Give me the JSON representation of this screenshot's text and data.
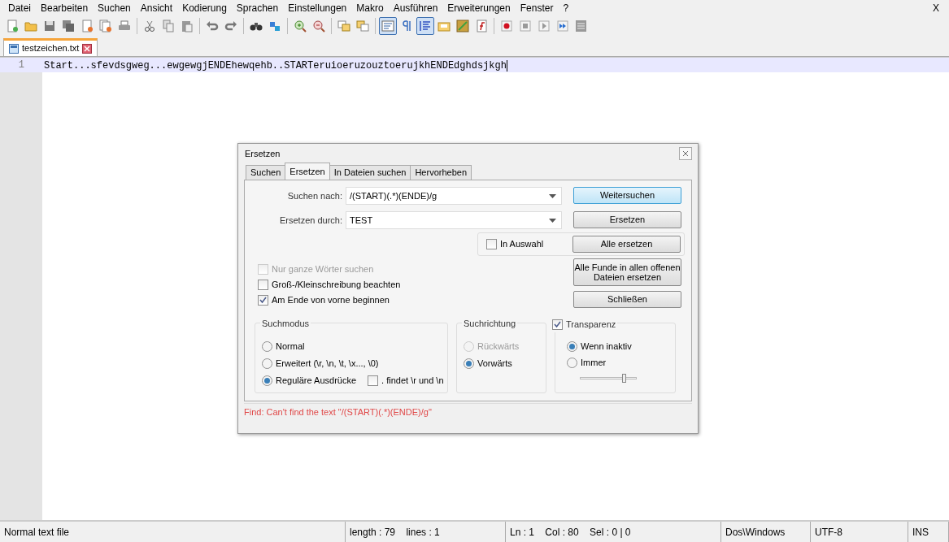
{
  "menu": [
    "Datei",
    "Bearbeiten",
    "Suchen",
    "Ansicht",
    "Kodierung",
    "Sprachen",
    "Einstellungen",
    "Makro",
    "Ausführen",
    "Erweiterungen",
    "Fenster",
    "?"
  ],
  "menu_close": "X",
  "toolbar": [
    {
      "pressed": false
    },
    {
      "pressed": false
    },
    {
      "pressed": false
    },
    {
      "pressed": false
    },
    {
      "pressed": false
    },
    {
      "pressed": false
    },
    {
      "pressed": false
    },
    {
      "pressed": false
    },
    {
      "pressed": false
    },
    {
      "pressed": false
    },
    {
      "pressed": false
    },
    {
      "pressed": false
    },
    {
      "pressed": false
    },
    {
      "pressed": false
    },
    {
      "pressed": false
    },
    {
      "pressed": false
    },
    {
      "pressed": false
    },
    {
      "pressed": false
    },
    {
      "pressed": true
    },
    {
      "pressed": false
    },
    {
      "pressed": true
    },
    {
      "pressed": false
    },
    {
      "pressed": false
    },
    {
      "pressed": false
    },
    {
      "pressed": false
    },
    {
      "pressed": false
    },
    {
      "pressed": false
    },
    {
      "pressed": false
    },
    {
      "pressed": false
    }
  ],
  "file_tabs": [
    {
      "label": "testzeichen.txt",
      "selected": true
    }
  ],
  "editor": {
    "lines": [
      {
        "number": "1",
        "text": "Start...sfevdsgweg...ewgewgjENDEhewqehb..STARTeruioeruzouztoerujkhENDEdghdsjkgh",
        "current": true
      }
    ]
  },
  "dialog": {
    "title": "Ersetzen",
    "tabs": [
      {
        "label": "Suchen",
        "selected": false
      },
      {
        "label": "Ersetzen",
        "selected": true
      },
      {
        "label": "In Dateien suchen",
        "selected": false
      },
      {
        "label": "Hervorheben",
        "selected": false
      }
    ],
    "fields": [
      {
        "label": "Suchen nach:",
        "value": "/(START)(.*)(ENDE)/g"
      },
      {
        "label": "Ersetzen durch:",
        "value": "TEST"
      }
    ],
    "in_selection": {
      "label": "In Auswahl",
      "checked": false,
      "disabled": false
    },
    "buttons": [
      {
        "label": "Weitersuchen",
        "default": true
      },
      {
        "label": "Ersetzen",
        "default": false
      },
      {
        "label": "Alle ersetzen",
        "default": false
      },
      {
        "label": "Alle Funde in allen offenen Dateien ersetzen",
        "default": false
      },
      {
        "label": "Schließen",
        "default": false
      }
    ],
    "options": [
      {
        "label": "Nur ganze Wörter suchen",
        "checked": false,
        "disabled": true
      },
      {
        "label": "Groß-/Kleinschreibung beachten",
        "checked": false,
        "disabled": false
      },
      {
        "label": "Am Ende von vorne beginnen",
        "checked": true,
        "disabled": false
      }
    ],
    "search_mode": {
      "title": "Suchmodus",
      "options": [
        {
          "label": "Normal",
          "selected": false
        },
        {
          "label": "Erweitert (\\r, \\n, \\t, \\x..., \\0)",
          "selected": false
        },
        {
          "label": "Reguläre Ausdrücke",
          "selected": true
        }
      ],
      "dot_newline": {
        "label": ". findet \\r und \\n",
        "checked": false
      }
    },
    "direction": {
      "title": "Suchrichtung",
      "options": [
        {
          "label": "Rückwärts",
          "selected": false,
          "disabled": true
        },
        {
          "label": "Vorwärts",
          "selected": true,
          "disabled": false
        }
      ]
    },
    "transparency": {
      "label": "Transparenz",
      "checked": true,
      "options": [
        {
          "label": "Wenn inaktiv",
          "selected": true
        },
        {
          "label": "Immer",
          "selected": false
        }
      ],
      "level": 0.8
    },
    "status": "Find: Can't find the text \"/(START)(.*)(ENDE)/g\""
  },
  "status_bar": [
    "Normal text file",
    "length : 79    lines : 1",
    "Ln : 1    Col : 80    Sel : 0 | 0",
    "Dos\\Windows",
    "UTF-8",
    "INS"
  ]
}
